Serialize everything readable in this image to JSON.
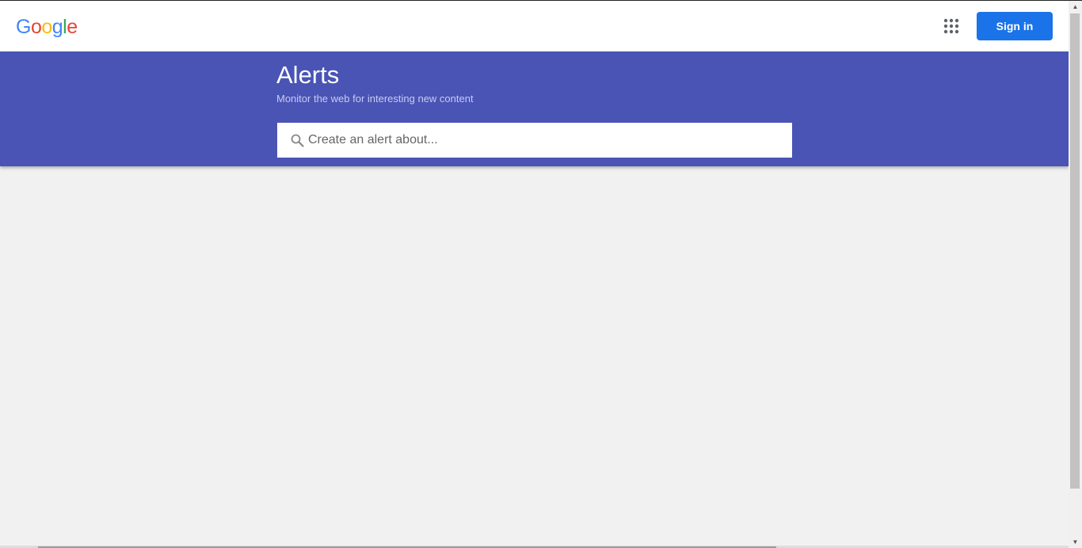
{
  "header": {
    "logo": {
      "letters": [
        "G",
        "o",
        "o",
        "g",
        "l",
        "e"
      ],
      "colors": [
        "#4285f4",
        "#ea4335",
        "#fbbc05",
        "#4285f4",
        "#34a853",
        "#ea4335"
      ]
    },
    "apps_icon": "apps-grid-icon",
    "sign_in_label": "Sign in",
    "sign_in_color": "#1a73e8"
  },
  "hero": {
    "title": "Alerts",
    "subtitle": "Monitor the web for interesting new content",
    "background": "#4a54b5",
    "search": {
      "icon": "search-icon",
      "placeholder": "Create an alert about...",
      "value": ""
    }
  }
}
